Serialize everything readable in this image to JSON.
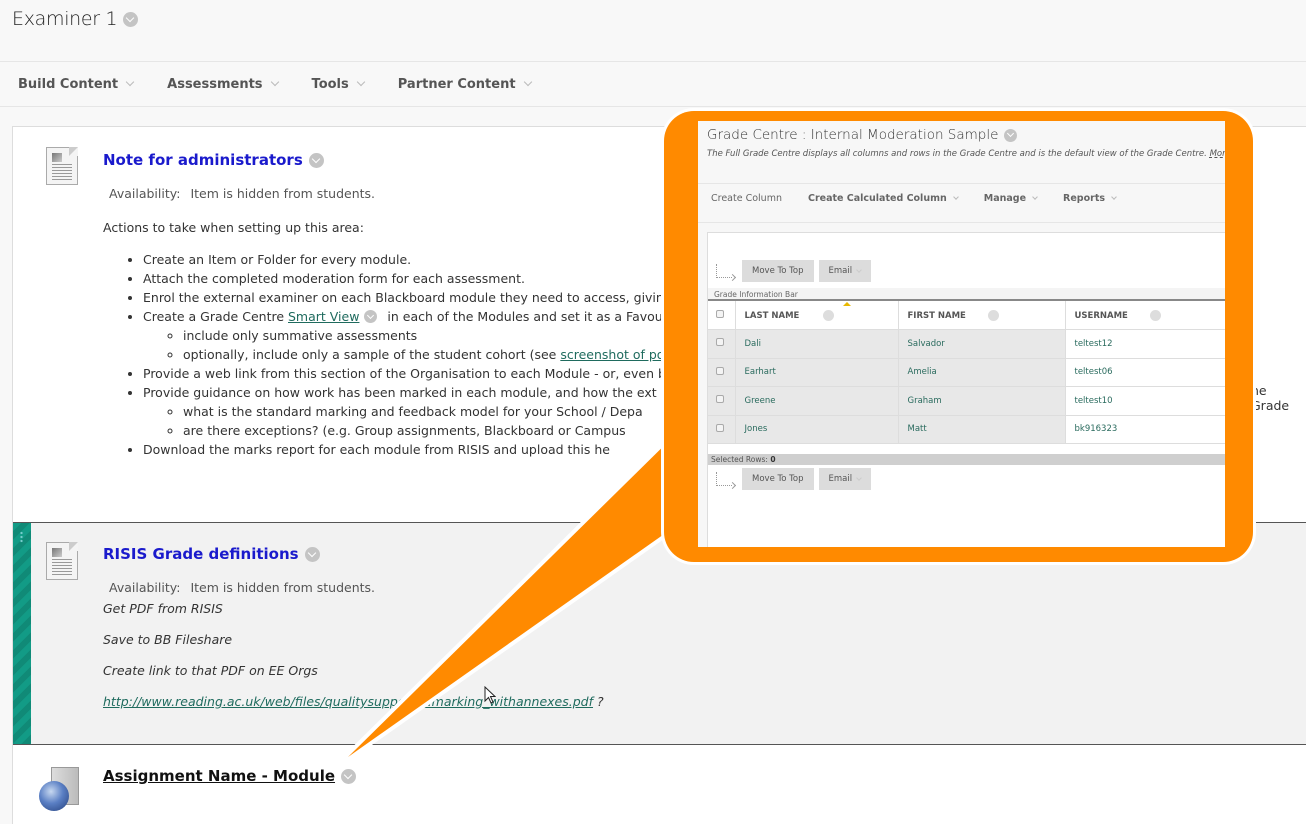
{
  "page": {
    "title": "Examiner 1"
  },
  "action_bar": {
    "items": [
      {
        "label": "Build Content"
      },
      {
        "label": "Assessments"
      },
      {
        "label": "Tools"
      },
      {
        "label": "Partner Content"
      }
    ]
  },
  "content_items": {
    "note": {
      "title": "Note for administrators",
      "icon": "document-icon",
      "availability_label": "Availability:",
      "availability_value": "Item is hidden from students.",
      "intro": "Actions to take when setting up this area:",
      "bullets": {
        "b1": "Create an Item or Folder for every module.",
        "b2": "Attach the completed moderation form for each assessment.",
        "b3": "Enrol the external examiner on each Blackboard module they need to access, giving th",
        "b4_pre": "Create a Grade Centre ",
        "b4_link": "Smart View",
        "b4_post": " in each of the Modules and set it as a Favourite",
        "b4_sub1": "include only summative assessments",
        "b4_sub2_pre": "optionally, include only a sample of the student cohort (see ",
        "b4_sub2_link": "screenshot of poss",
        "b5": "Provide a web link from this section of the Organisation to each Module - or, even be",
        "b6": "Provide guidance on how work has been marked in each module, and how the ext",
        "b6_sub1": "what is the standard marking and feedback model for your School / Depa",
        "b6_sub2": "are there exceptions? (e.g. Group assignments, Blackboard or Campus",
        "b7": "Download the marks report for each module from RISIS and upload this he"
      },
      "right_fragment": "ne Grade"
    },
    "risis": {
      "title": "RISIS Grade definitions",
      "icon": "document-icon",
      "availability_label": "Availability:",
      "availability_value": "Item is hidden from students.",
      "lines": {
        "l1": "Get PDF from RISIS",
        "l2": "Save to BB Fileshare",
        "l3": "Create link to that PDF on EE Orgs",
        "l4_link": "http://www.reading.ac.uk/web/files/qualitysupport/...marking_withannexes.pdf",
        "l4_suffix": " ?"
      }
    },
    "assignment": {
      "title": "Assignment Name - Module",
      "icon": "web-link-globe-icon"
    }
  },
  "callout": {
    "accent_color": "#ff8a00",
    "grade_centre": {
      "title": "Grade Centre : Internal Moderation Sample",
      "description": "The Full Grade Centre displays all columns and rows in the Grade Centre and is the default view of the Grade Centre. ",
      "more_help": "More H",
      "toolbar": {
        "create_column": "Create Column",
        "create_calculated_column": "Create Calculated Column",
        "manage": "Manage",
        "reports": "Reports"
      },
      "buttons": {
        "move_to_top": "Move To Top",
        "email": "Email"
      },
      "info_bar": "Grade Information Bar",
      "columns": {
        "last_name": "LAST NAME",
        "first_name": "FIRST NAME",
        "username": "USERNAME"
      },
      "rows": [
        {
          "last": "Dali",
          "first": "Salvador",
          "username": "teltest12"
        },
        {
          "last": "Earhart",
          "first": "Amelia",
          "username": "teltest06"
        },
        {
          "last": "Greene",
          "first": "Graham",
          "username": "teltest10"
        },
        {
          "last": "Jones",
          "first": "Matt",
          "username": "bk916323"
        }
      ],
      "selected_rows_label": "Selected Rows: ",
      "selected_rows_count": "0"
    }
  }
}
